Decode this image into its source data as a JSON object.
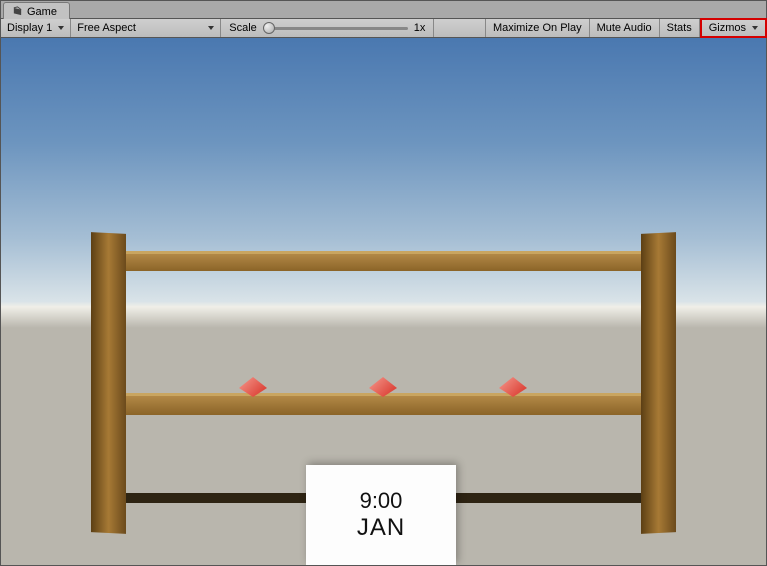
{
  "tab": {
    "label": "Game"
  },
  "toolbar": {
    "display_label": "Display 1",
    "aspect_label": "Free Aspect",
    "scale_label": "Scale",
    "scale_value": "1x",
    "maximize": "Maximize On Play",
    "mute": "Mute Audio",
    "stats": "Stats",
    "gizmos": "Gizmos"
  },
  "scene": {
    "card_time": "9:00",
    "card_month": "JAN"
  }
}
